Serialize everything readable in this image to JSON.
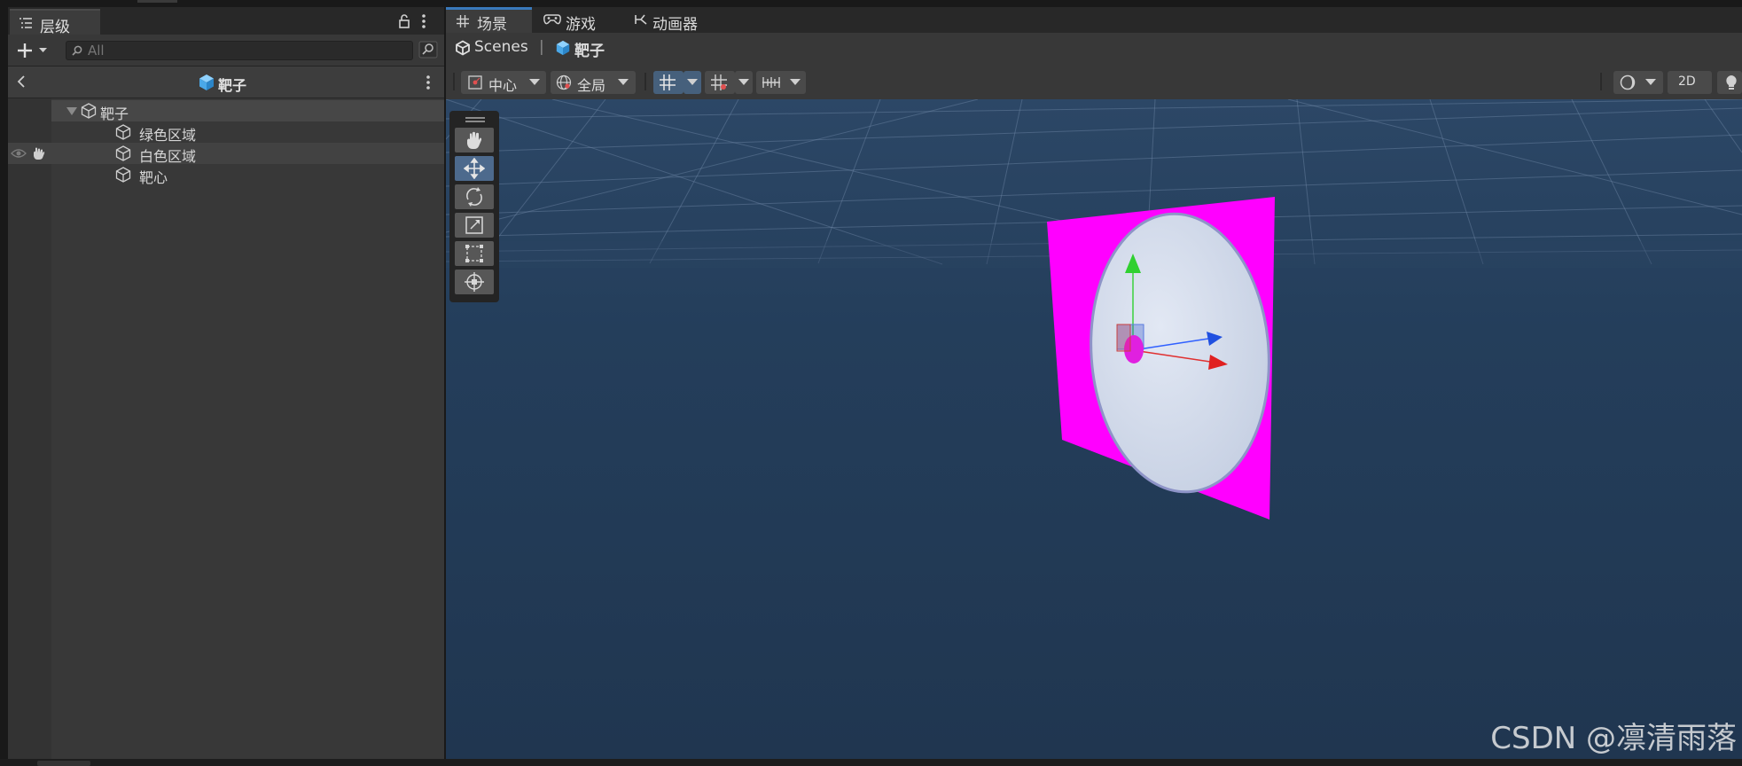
{
  "hierarchy": {
    "tab_label": "层级",
    "search": {
      "placeholder": "All"
    },
    "header_title": "靶子",
    "items": [
      {
        "label": "靶子",
        "depth": 0,
        "expanded": true
      },
      {
        "label": "绿色区域",
        "depth": 1
      },
      {
        "label": "白色区域",
        "depth": 1,
        "hovered": true
      },
      {
        "label": "靶心",
        "depth": 1
      }
    ]
  },
  "scene_tabs": [
    {
      "label": "场景",
      "icon": "grid-icon",
      "active": true
    },
    {
      "label": "游戏",
      "icon": "gamepad-icon"
    },
    {
      "label": "动画器",
      "icon": "animator-icon"
    }
  ],
  "breadcrumb": {
    "root": "Scenes",
    "separator": "|",
    "current": "靶子"
  },
  "toolbar": {
    "pivot_label": "中心",
    "space_label": "全局",
    "mode_2d": "2D"
  },
  "tools": [
    "hand-tool",
    "move-tool",
    "rotate-tool",
    "scale-tool",
    "rect-tool",
    "transform-tool"
  ],
  "active_tool": "move-tool",
  "colors": {
    "sky": "#203650",
    "target_frame": "#ff00ff",
    "white_area": "#cfd8ea",
    "bullseye": "#e020e0",
    "axis_x": "#e02020",
    "axis_y": "#30d030",
    "axis_z": "#2050e0",
    "accent": "#3a79bb"
  },
  "watermark": "CSDN @凛清雨落"
}
